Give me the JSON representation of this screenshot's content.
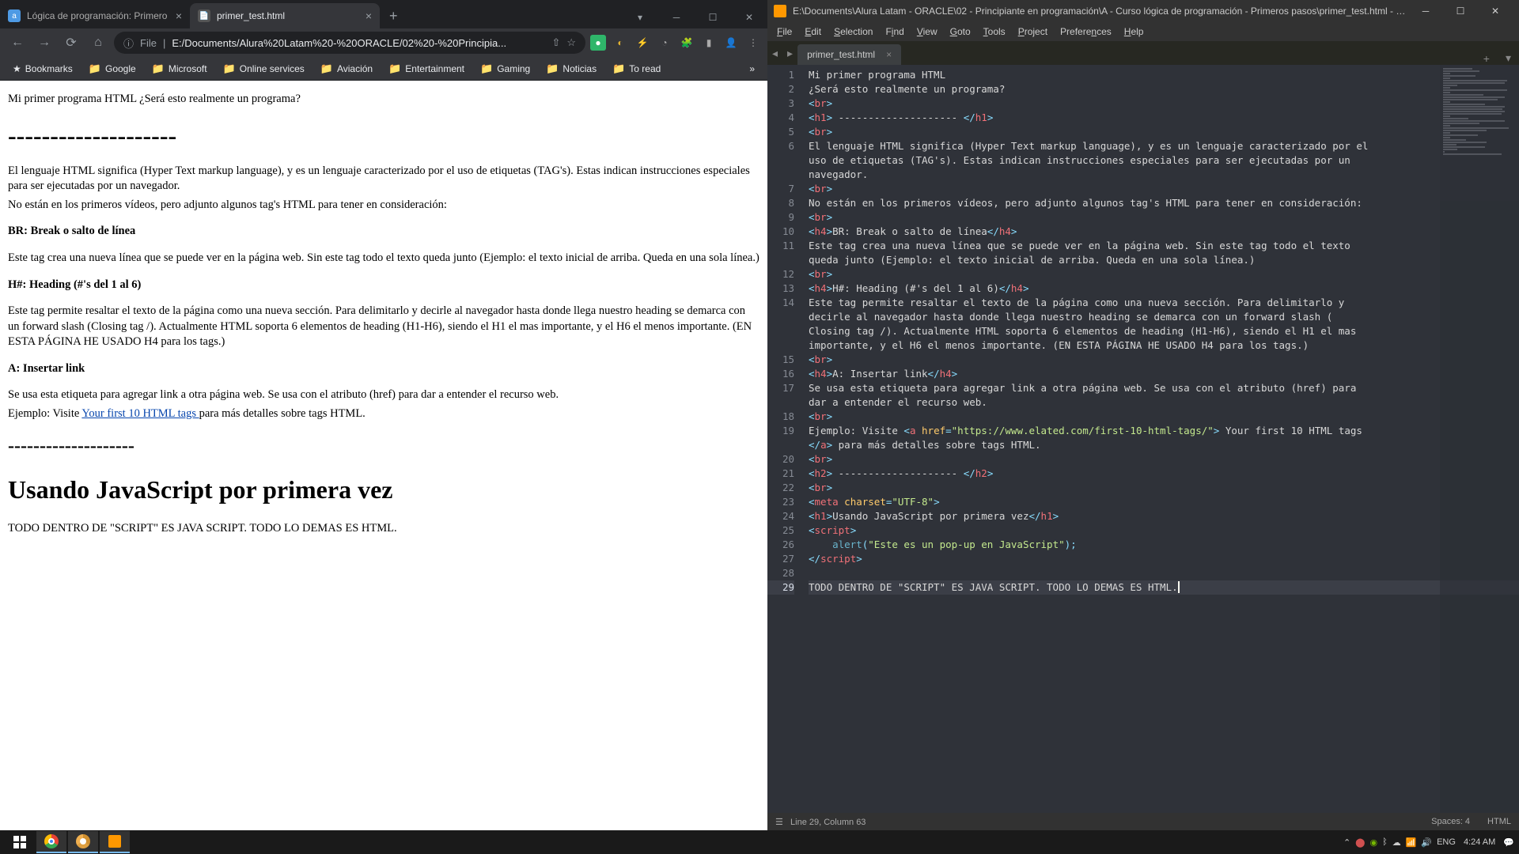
{
  "chrome": {
    "tabs": [
      {
        "title": "Lógica de programación: Primero",
        "favicon": "a"
      },
      {
        "title": "primer_test.html",
        "favicon": "📄"
      }
    ],
    "url_scheme": "File",
    "url_path": "E:/Documents/Alura%20Latam%20-%20ORACLE/02%20-%20Principia...",
    "bookmarks": [
      "Bookmarks",
      "Google",
      "Microsoft",
      "Online services",
      "Aviación",
      "Entertainment",
      "Gaming",
      "Noticias",
      "To read"
    ],
    "bookmark_overflow": "»"
  },
  "page": {
    "intro": "Mi primer programa HTML ¿Será esto realmente un programa?",
    "hr1": "--------------------",
    "para1": "El lenguaje HTML significa (Hyper Text markup language), y es un lenguaje caracterizado por el uso de etiquetas (TAG's). Estas indican instrucciones especiales para ser ejecutadas por un navegador.",
    "para2": "No están en los primeros vídeos, pero adjunto algunos tag's HTML para tener en consideración:",
    "h_br": "BR: Break o salto de línea",
    "p_br": "Este tag crea una nueva línea que se puede ver en la página web. Sin este tag todo el texto queda junto (Ejemplo: el texto inicial de arriba. Queda en una sola línea.)",
    "h_hash": "H#: Heading (#'s del 1 al 6)",
    "p_hash": "Este tag permite resaltar el texto de la página como una nueva sección. Para delimitarlo y decirle al navegador hasta donde llega nuestro heading se demarca con un forward slash (Closing tag /). Actualmente HTML soporta 6 elementos de heading (H1-H6), siendo el H1 el mas importante, y el H6 el menos importante. (EN ESTA PÁGINA HE USADO H4 para los tags.)",
    "h_a": "A: Insertar link",
    "p_a1": "Se usa esta etiqueta para agregar link a otra página web. Se usa con el atributo (href) para dar a entender el recurso web.",
    "p_a2_pre": "Ejemplo: Visite ",
    "link_text": "Your first 10 HTML tags ",
    "p_a2_post": "para más detalles sobre tags HTML.",
    "hr2": "--------------------",
    "h1_js": "Usando JavaScript por primera vez",
    "p_js": "TODO DENTRO DE \"SCRIPT\" ES JAVA SCRIPT. TODO LO DEMAS ES HTML."
  },
  "sublime": {
    "title": "E:\\Documents\\Alura Latam - ORACLE\\02 - Principiante en programación\\A - Curso lógica de programación - Primeros pasos\\primer_test.html - Su...",
    "menus": [
      "File",
      "Edit",
      "Selection",
      "Find",
      "View",
      "Goto",
      "Tools",
      "Project",
      "Preferences",
      "Help"
    ],
    "tab": "primer_test.html",
    "status_left": "Line 29, Column 63",
    "status_spaces": "Spaces: 4",
    "status_lang": "HTML",
    "line_count": 29,
    "active_line": 29,
    "code": {
      "l1": "Mi primer programa HTML",
      "l2": "¿Será esto realmente un programa?",
      "l4": " -------------------- ",
      "l6": "El lenguaje HTML significa (Hyper Text markup language), y es un lenguaje caracterizado por el",
      "l6b": "uso de etiquetas (TAG's). Estas indican instrucciones especiales para ser ejecutadas por un",
      "l6c": "navegador.",
      "l8": "No están en los primeros vídeos, pero adjunto algunos tag's HTML para tener en consideración:",
      "l10": "BR: Break o salto de línea",
      "l11": "Este tag crea una nueva línea que se puede ver en la página web. Sin este tag todo el texto",
      "l11b": "queda junto (Ejemplo: el texto inicial de arriba. Queda en una sola línea.)",
      "l13": "H#: Heading (#'s del 1 al 6)",
      "l14": "Este tag permite resaltar el texto de la página como una nueva sección. Para delimitarlo y",
      "l14b": "decirle al navegador hasta donde llega nuestro heading se demarca con un forward slash (",
      "l14c": "Closing tag /). Actualmente HTML soporta 6 elementos de heading (H1-H6), siendo el H1 el mas",
      "l14d": "importante, y el H6 el menos importante. (EN ESTA PÁGINA HE USADO H4 para los tags.)",
      "l16": "A: Insertar link",
      "l17": "Se usa esta etiqueta para agregar link a otra página web. Se usa con el atributo (href) para",
      "l17b": "dar a entender el recurso web.",
      "l19a": "Ejemplo: Visite ",
      "l19_href": "\"https://www.elated.com/first-10-html-tags/\"",
      "l19b": " Your first 10 HTML tags",
      "l19c": " para más detalles sobre tags HTML.",
      "l21": " -------------------- ",
      "l23_charset": "\"UTF-8\"",
      "l24": "Usando JavaScript por primera vez",
      "l26_alert": "\"Este es un pop-up en JavaScript\"",
      "l29": "TODO DENTRO DE \"SCRIPT\" ES JAVA SCRIPT. TODO LO DEMAS ES HTML."
    }
  },
  "taskbar": {
    "time": "4:24 AM",
    "date": "🔔"
  }
}
